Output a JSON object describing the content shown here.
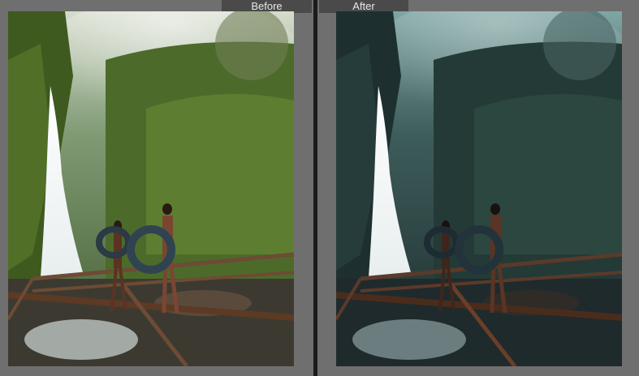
{
  "labels": {
    "before": "Before",
    "after": "After"
  },
  "colors": {
    "background": "#6f6f6f",
    "divider": "#1b1b1b",
    "label_tab": "#4a4a4a",
    "label_text": "#e8e8e8"
  },
  "panes": [
    {
      "id": "before",
      "style": "original-warm-green"
    },
    {
      "id": "after",
      "style": "teal-moody-edit"
    }
  ]
}
